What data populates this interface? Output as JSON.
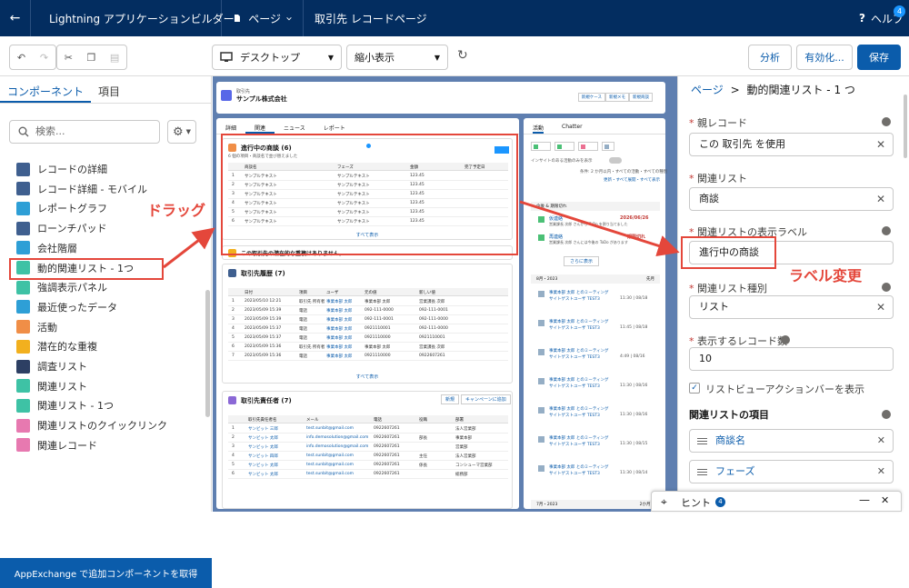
{
  "topbar": {
    "back": "←",
    "app_title": "Lightning アプリケーションビルダー",
    "page_menu": "ページ",
    "page_name": "取引先 レコードページ",
    "help": "ヘルプ",
    "help_badge": "4"
  },
  "toolbar": {
    "device": "デスクトップ",
    "view": "縮小表示",
    "analyze": "分析",
    "activate": "有効化...",
    "save": "保存"
  },
  "left": {
    "tabs": [
      "コンポーネント",
      "項目"
    ],
    "search_placeholder": "検索...",
    "components": [
      {
        "label": "レコードの詳細",
        "color": "#3f5f8f"
      },
      {
        "label": "レコード詳細 - モバイル",
        "color": "#3f5f8f"
      },
      {
        "label": "レポートグラフ",
        "color": "#2e9fd6"
      },
      {
        "label": "ローンチパッド",
        "color": "#3f5f8f"
      },
      {
        "label": "会社階層",
        "color": "#2e9fd6"
      },
      {
        "label": "動的関連リスト - 1つ",
        "color": "#3ec2a5"
      },
      {
        "label": "強調表示パネル",
        "color": "#3ec2a5"
      },
      {
        "label": "最近使ったデータ",
        "color": "#2e9fd6"
      },
      {
        "label": "活動",
        "color": "#f08e47"
      },
      {
        "label": "潜在的な重複",
        "color": "#f2b01e"
      },
      {
        "label": "調査リスト",
        "color": "#2d3f63"
      },
      {
        "label": "関連リスト",
        "color": "#3ec2a5"
      },
      {
        "label": "関連リスト - 1つ",
        "color": "#3ec2a5"
      },
      {
        "label": "関連リストのクイックリンク",
        "color": "#e779b0"
      },
      {
        "label": "関連レコード",
        "color": "#e779b0"
      }
    ],
    "appexchange": "AppExchange で追加コンポーネントを取得"
  },
  "canvas": {
    "account_type": "取引先",
    "account_name": "サンプル株式会社",
    "header_buttons": [
      "新規ケース",
      "新規メモ",
      "新規商談"
    ],
    "tabs": [
      "詳細",
      "関連",
      "ニュース",
      "レポート"
    ],
    "opp": {
      "title": "進行中の商談 (6)",
      "sub": "6 個の項目・商談名で並び替えました",
      "cols": [
        "商談名",
        "フェーズ",
        "金額",
        "完了予定日"
      ],
      "rows": [
        [
          "1",
          "サンプルテキスト",
          "サンプルテキスト",
          "123.45"
        ],
        [
          "2",
          "サンプルテキスト",
          "サンプルテキスト",
          "123.45"
        ],
        [
          "3",
          "サンプルテキスト",
          "サンプルテキスト",
          "123.45"
        ],
        [
          "4",
          "サンプルテキスト",
          "サンプルテキスト",
          "123.45"
        ],
        [
          "5",
          "サンプルテキスト",
          "サンプルテキスト",
          "123.45"
        ],
        [
          "6",
          "サンプルテキスト",
          "サンプルテキスト",
          "123.45"
        ]
      ],
      "view_all": "すべて表示"
    },
    "dup_msg": "この取引先の潜在的な重複はありません。",
    "history": {
      "title": "取引先履歴 (7)",
      "cols": [
        "日付",
        "項目",
        "ユーザ",
        "元の値",
        "新しい値"
      ],
      "rows": [
        [
          "1",
          "2023/05/10 12:21",
          "取引先 所有者",
          "事業本部 太郎",
          "事業本部 太郎",
          "営業課長 次郎"
        ],
        [
          "2",
          "2023/05/09 15:39",
          "電話",
          "事業本部 太郎",
          "092-111-0000",
          "092-111-0001"
        ],
        [
          "3",
          "2023/05/09 15:39",
          "電話",
          "事業本部 太郎",
          "092-111-0001",
          "092-111-0000"
        ],
        [
          "4",
          "2023/05/09 15:37",
          "電話",
          "事業本部 太郎",
          "0921110001",
          "092-111-0000"
        ],
        [
          "5",
          "2023/05/09 15:37",
          "電話",
          "事業本部 太郎",
          "0921110000",
          "0921110001"
        ],
        [
          "6",
          "2023/05/09 15:36",
          "取引先 所有者",
          "事業本部 太郎",
          "事業本部 太郎",
          "営業課長 次郎"
        ],
        [
          "7",
          "2023/05/09 15:36",
          "電話",
          "事業本部 太郎",
          "0921110000",
          "0922607261"
        ]
      ],
      "view_all": "すべて表示"
    },
    "contacts": {
      "title": "取引先責任者 (7)",
      "new": "新規",
      "add": "キャンペーンに追加",
      "cols": [
        "取引先責任者名",
        "メール",
        "電話",
        "役職",
        "部署"
      ],
      "rows": [
        [
          "1",
          "サンビット 三郎",
          "test.sunbit@gmail.com",
          "0922607261",
          "",
          "法人営業部"
        ],
        [
          "2",
          "サンビット 太郎",
          "info.demosolution@gmail.com",
          "0922607261",
          "部長",
          "事業本部"
        ],
        [
          "3",
          "サンビット 太郎",
          "info.demosolution@gmail.com",
          "0922607261",
          "",
          "営業部"
        ],
        [
          "4",
          "サンビット 四郎",
          "test.sunbit@gmail.com",
          "0922607261",
          "主任",
          "法人営業部"
        ],
        [
          "5",
          "サンビット 太郎",
          "test.sunbit@gmail.com",
          "0922607261",
          "係長",
          "コンシューマ営業部"
        ],
        [
          "6",
          "サンビット 太郎",
          "test.sunbit@gmail.com",
          "0922607261",
          "",
          "総務部"
        ]
      ]
    },
    "activity": {
      "tabs": [
        "活動",
        "Chatter"
      ],
      "toggle_label": "インサイトのある活動のみを表示",
      "filter": "条件: 2 か月以内・すべての活動・すべての種別",
      "links": "更新・すべて展開・すべて表示",
      "upcoming": "今後 & 期限切れ",
      "item1_date": "2026/06/26",
      "item1_title": "仮連絡",
      "item1_text": "営業課長 次郎 さんから ToDo を割り当てました",
      "item2_date": "期限切れ",
      "item2_title": "再連絡",
      "item2_text": "営業課長 次郎 さんには今後の ToDo があります",
      "more": "さらに表示",
      "month1": "8月・2023",
      "month1_right": "先月",
      "events": [
        [
          "事業本部 太郎 とのミーティング",
          "サイトゲストユーザ TEST3",
          "11:30 | 08/18"
        ],
        [
          "事業本部 太郎 とのミーティング",
          "サイトゲストユーザ TEST3",
          "11:45 | 08/18"
        ],
        [
          "事業本部 太郎 とのミーティング",
          "サイトゲストユーザ TEST3",
          "4:49 | 08/16"
        ],
        [
          "事業本部 太郎 とのミーティング",
          "サイトゲストユーザ TEST3",
          "11:30 | 08/16"
        ],
        [
          "事業本部 太郎 とのミーティング",
          "サイトゲストユーザ TEST3",
          "11:30 | 08/16"
        ],
        [
          "事業本部 太郎 とのミーティング",
          "サイトゲストユーザ TEST3",
          "11:30 | 08/15"
        ],
        [
          "事業本部 太郎 とのミーティング",
          "サイトゲストユーザ TEST3",
          "11:30 | 08/14"
        ]
      ],
      "month2": "7月・2023",
      "month2_right": "2か月前"
    }
  },
  "props": {
    "breadcrumb_root": "ページ",
    "breadcrumb_sep": ">",
    "breadcrumb_current": "動的関連リスト - 1 つ",
    "parent_label": "親レコード",
    "parent_value": "この 取引先 を使用",
    "rel_label": "関連リスト",
    "rel_value": "商談",
    "rel_lbl_label": "関連リストの表示ラベル",
    "rel_lbl_value": "進行中の商談",
    "type_label": "関連リスト種別",
    "type_value": "リスト",
    "count_label": "表示するレコード数",
    "count_value": "10",
    "show_actions": "リストビューアクションバーを表示",
    "items_label": "関連リストの項目",
    "fields": [
      "商談名",
      "フェーズ"
    ],
    "hint": "ヒント",
    "hint_badge": "4"
  },
  "annotations": {
    "drag": "ドラッグ",
    "label_change": "ラベル変更"
  }
}
